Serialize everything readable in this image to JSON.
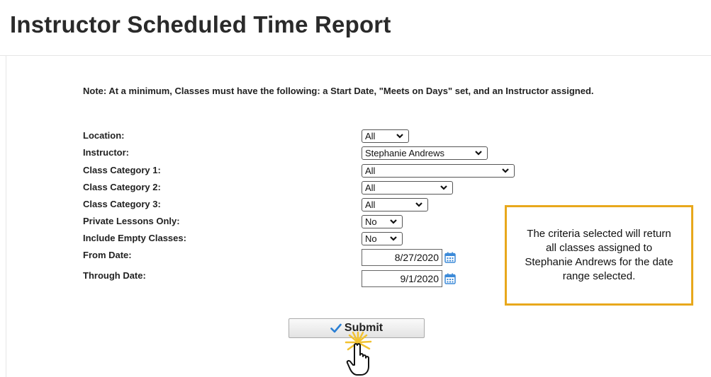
{
  "page": {
    "title": "Instructor Scheduled Time Report",
    "note": "Note:  At a minimum, Classes must have the following: a Start Date, \"Meets on Days\" set, and an Instructor assigned."
  },
  "form": {
    "location": {
      "label": "Location:",
      "value": "All"
    },
    "instructor": {
      "label": "Instructor:",
      "value": "Stephanie Andrews"
    },
    "class_category_1": {
      "label": "Class Category 1:",
      "value": "All"
    },
    "class_category_2": {
      "label": "Class Category 2:",
      "value": "All"
    },
    "class_category_3": {
      "label": "Class Category 3:",
      "value": "All"
    },
    "private_lessons_only": {
      "label": "Private Lessons Only:",
      "value": "No"
    },
    "include_empty_classes": {
      "label": "Include Empty Classes:",
      "value": "No"
    },
    "from_date": {
      "label": "From Date:",
      "value": "8/27/2020"
    },
    "through_date": {
      "label": "Through Date:",
      "value": "9/1/2020"
    }
  },
  "submit": {
    "label": "Submit"
  },
  "callout": {
    "text": "The criteria selected will return all classes assigned to Stephanie Andrews for the date range selected."
  },
  "colors": {
    "callout_border": "#e8a81c",
    "check_icon": "#2a7fd4",
    "calendar_icon": "#3c8ad8",
    "pointer_burst": "#f2c230"
  },
  "icons": [
    "chevron-down-icon",
    "calendar-icon",
    "checkmark-icon",
    "hand-pointer-icon"
  ]
}
